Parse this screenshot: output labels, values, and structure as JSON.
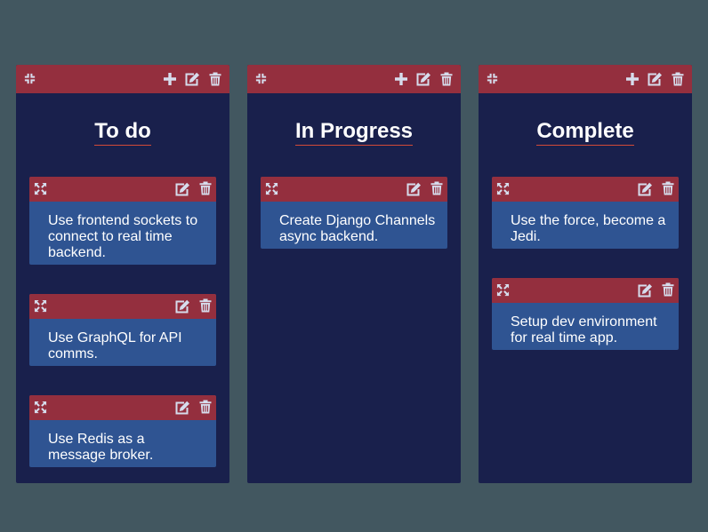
{
  "columns": [
    {
      "title": "To do",
      "cards": [
        {
          "text": "Use frontend sockets to connect to real time backend."
        },
        {
          "text": "Use GraphQL for API comms."
        },
        {
          "text": "Use Redis as a message broker."
        }
      ]
    },
    {
      "title": "In Progress",
      "cards": [
        {
          "text": "Create Django Channels async backend."
        }
      ]
    },
    {
      "title": "Complete",
      "cards": [
        {
          "text": "Use the force, become a Jedi."
        },
        {
          "text": "Setup dev environment for real time app."
        }
      ]
    }
  ],
  "icons": {
    "collapse": "collapse-icon",
    "expand": "expand-icon",
    "add": "plus-icon",
    "edit": "edit-icon",
    "delete": "trash-icon"
  },
  "colors": {
    "background": "#425760",
    "column": "#19204c",
    "header": "#942f3e",
    "card": "#2f5492",
    "icon": "#d6dcec",
    "title_underline": "#d24a38"
  }
}
